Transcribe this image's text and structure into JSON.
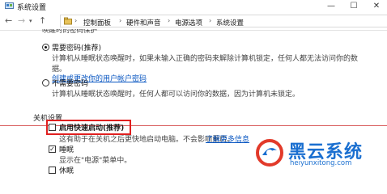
{
  "window": {
    "title": "系统设置",
    "controls": {
      "minimize": "—",
      "maximize": "☐",
      "close": "✕"
    }
  },
  "nav": {
    "back": "←",
    "forward": "→",
    "up": "↑",
    "breadcrumbs": [
      "控制面板",
      "硬件和声音",
      "电源选项",
      "系统设置"
    ],
    "separator": "›"
  },
  "password": {
    "section_header": "唤醒时的密码保护",
    "require": {
      "label": "需要密码(推荐)",
      "selected": true,
      "desc1": "计算机从睡眠状态唤醒时，如果未输入正确的密码来解除计算机锁定，任何人都无法访问你的数",
      "desc2": "据。",
      "link": "创建或更改你的用户帐户密码"
    },
    "no_require": {
      "label": "不需要密码",
      "selected": false,
      "desc": "计算机从睡眠状态唤醒时，任何人都可以访问你的数据，因为计算机未锁定。"
    }
  },
  "shutdown": {
    "header": "关机设置",
    "fast_startup": {
      "label": "启用快速启动(推荐)",
      "checked": false,
      "desc_part1": "这有助于在关机之后更快地启动电脑。不会影响重启。",
      "link": "了解更多信息"
    },
    "sleep": {
      "label": "睡眠",
      "checked": true,
      "desc": "显示在\"电源\"菜单中。"
    },
    "hibernate": {
      "label": "休眠"
    }
  },
  "watermark": {
    "brand": "黑云系统",
    "url": "heiyunxitong.com",
    "color": "#1a6fd0"
  },
  "colors": {
    "highlight": "#e02020",
    "link": "#0a57c2"
  }
}
